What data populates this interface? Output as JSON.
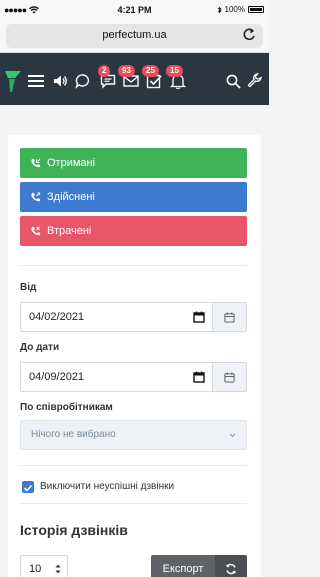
{
  "status_bar": {
    "time": "4:21 PM",
    "battery": "100%"
  },
  "browser": {
    "url": "perfectum.ua"
  },
  "navbar": {
    "badges": {
      "messages": "2",
      "mail": "93",
      "tasks": "25",
      "notifications": "15"
    }
  },
  "call_filters": {
    "received_label": "Отримані",
    "made_label": "Здійснені",
    "missed_label": "Втрачені"
  },
  "filters": {
    "from_label": "Від",
    "from_value": "04/02/2021",
    "to_label": "До дати",
    "to_value": "04/09/2021",
    "employee_label": "По співробітникам",
    "employee_placeholder": "Нічого не вибрано",
    "exclude_failed_label": "Виключити неуспішні дзвінки",
    "exclude_failed_checked": true
  },
  "history": {
    "title": "Історія дзвінків",
    "page_size": "10",
    "export_label": "Експорт"
  },
  "colors": {
    "navbar": "#2b3643",
    "green": "#3fb25a",
    "blue": "#3d7bd0",
    "red": "#e8566a",
    "badge": "#e7505a"
  }
}
